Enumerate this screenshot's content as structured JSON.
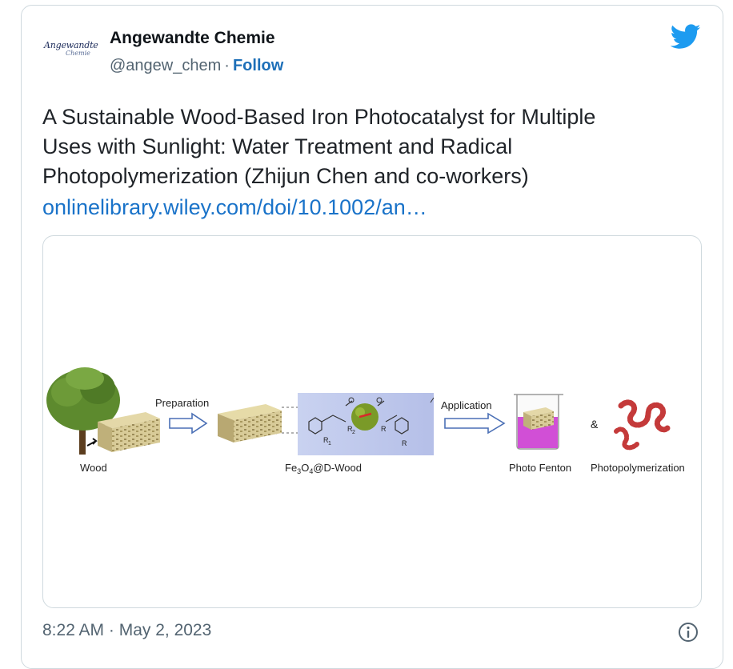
{
  "author": {
    "logo_line1": "Angewandte",
    "logo_line2": "Chemie",
    "name": "Angewandte Chemie",
    "handle": "@angew_chem",
    "separator": "·",
    "follow_label": "Follow"
  },
  "tweet": {
    "text": "A Sustainable Wood-Based Iron Photocatalyst for Multiple\nUses with Sunlight: Water Treatment and Radical\nPhotopolymerization (Zhijun Chen and co-workers)",
    "link_text": "onlinelibrary.wiley.com/doi/10.1002/an…",
    "timestamp": "8:22 AM · May 2, 2023"
  },
  "figure": {
    "wood_label": "Wood",
    "preparation_label": "Preparation",
    "fe_label_prefix": "Fe",
    "fe_sub1": "3",
    "fe_mid": "O",
    "fe_sub2": "4",
    "fe_label_suffix": "@D-Wood",
    "r1_label": "R",
    "r1_sub": "1",
    "r2_label": "R",
    "r2_sub": "2",
    "r_label_a": "R",
    "r_label_b": "R",
    "application_label": "Application",
    "ampersand": "&",
    "photo_fenton_label": "Photo Fenton",
    "photopolymerization_label": "Photopolymerization"
  },
  "icons": {
    "brand": "twitter-bird-icon",
    "info": "info-icon"
  },
  "colors": {
    "twitter_blue": "#1d9bf0",
    "link_blue": "#1a73c9",
    "muted_gray": "#536471",
    "panel_lavender": "#b8c2ea",
    "beaker_magenta": "#d14fd6",
    "polymer_red": "#c43a3a",
    "wood_tan": "#cfc08a",
    "tree_green": "#5d8a2e"
  }
}
